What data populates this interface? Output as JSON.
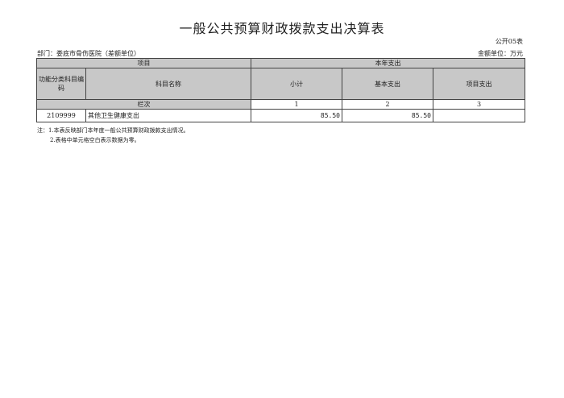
{
  "title": "一般公共预算财政拨款支出决算表",
  "form_code": "公开05表",
  "department": "部门：娄底市骨伤医院（差额单位）",
  "amount_unit": "金额单位：万元",
  "table": {
    "header_project": "项目",
    "header_current_year": "本年支出",
    "col_code": "功能分类科目编码",
    "col_name": "科目名称",
    "col_subtotal": "小计",
    "col_basic": "基本支出",
    "col_project": "项目支出",
    "row_index_label": "栏次",
    "index_1": "1",
    "index_2": "2",
    "index_3": "3",
    "rows": [
      {
        "code": "2109999",
        "name": "其他卫生健康支出",
        "subtotal": "85.50",
        "basic": "85.50",
        "project": ""
      }
    ]
  },
  "notes": [
    "注：1.本表反映部门本年度一般公共预算财政拨款支出情况。",
    "2.表格中单元格空白表示数据为零。"
  ]
}
